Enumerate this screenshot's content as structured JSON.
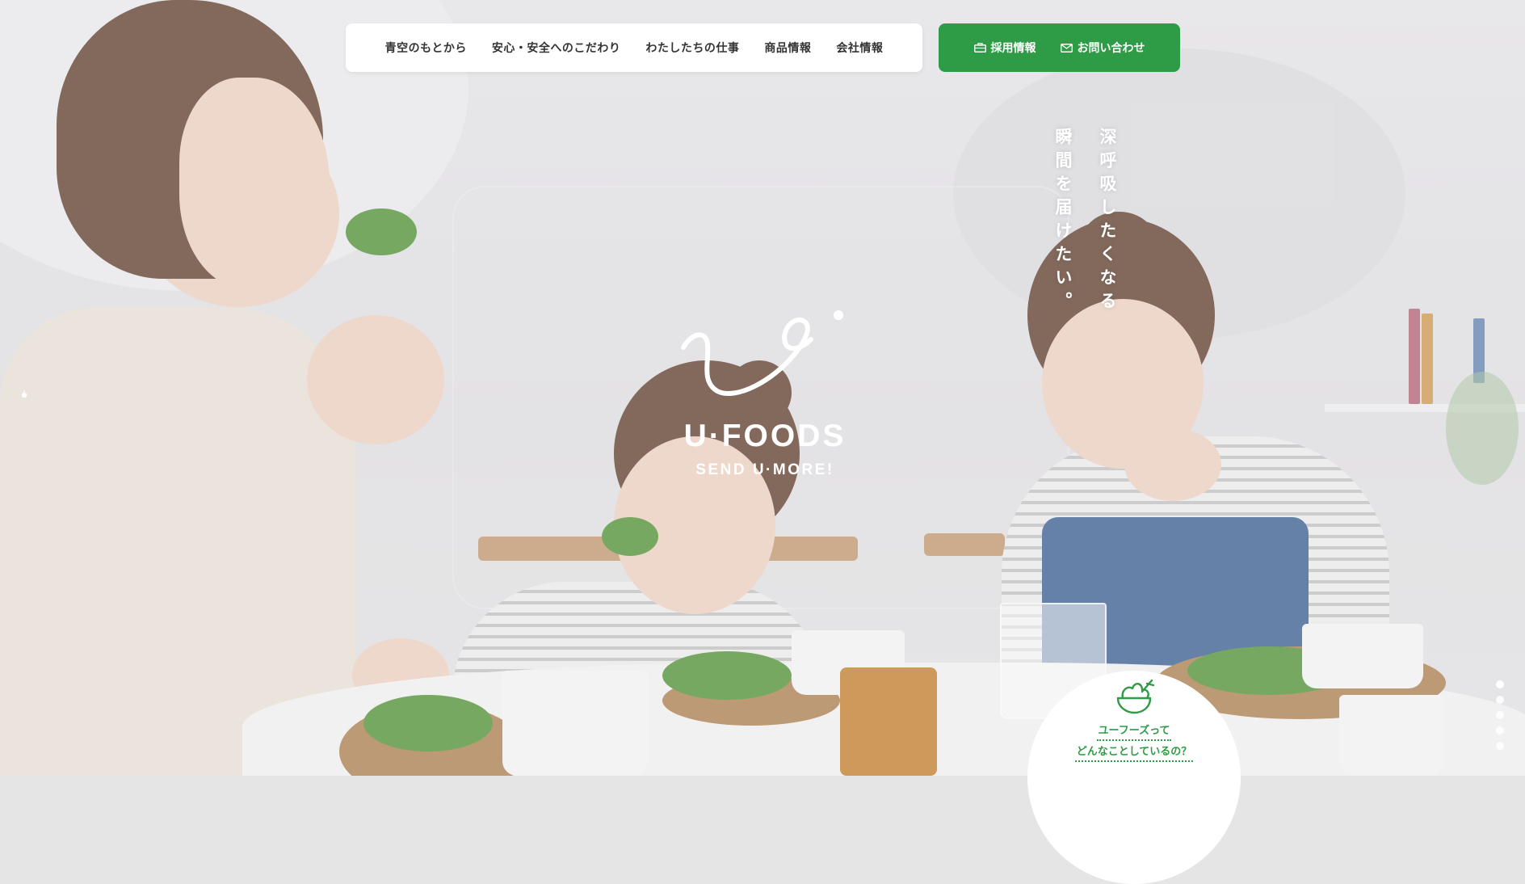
{
  "nav": {
    "items": [
      {
        "label": "青空のもとから"
      },
      {
        "label": "安心・安全へのこだわり"
      },
      {
        "label": "わたしたちの仕事"
      },
      {
        "label": "商品情報"
      },
      {
        "label": "会社情報"
      }
    ]
  },
  "cta": {
    "recruit_label": "採用情報",
    "contact_label": "お問い合わせ",
    "recruit_icon": "briefcase-icon",
    "contact_icon": "mail-icon"
  },
  "hero": {
    "catch_line1": "深呼吸したくなる",
    "catch_line2": "瞬間を届けたい。"
  },
  "logo": {
    "name": "U·FOODS",
    "tagline": "SEND U·MORE!"
  },
  "bubble": {
    "icon": "vegetables-icon",
    "line1": "ユーフーズって",
    "line2": "どんなことしているの？"
  },
  "slider": {
    "count": 5,
    "active": 0
  },
  "colors": {
    "brand_green": "#2e9b46",
    "nav_bg": "#ffffff",
    "text_dark": "#333333"
  }
}
